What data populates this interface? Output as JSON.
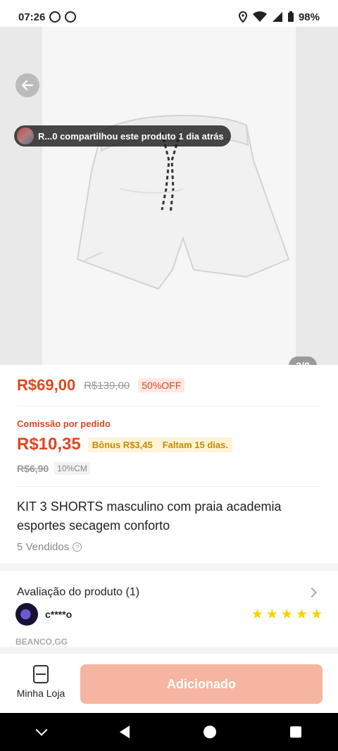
{
  "status_bar": {
    "time": "07:26",
    "battery": "98%"
  },
  "gallery": {
    "share_text": "R...0 compartilhou este produto 1 dia atrás",
    "counter": "2/8"
  },
  "pricing": {
    "price": "R$69,00",
    "old_price": "R$139,00",
    "discount": "50%OFF"
  },
  "commission": {
    "label": "Comissão por pedido",
    "amount": "R$10,35",
    "bonus": "Bônus R$3,45",
    "remaining": "Faltam 15 dias.",
    "old_amount": "R$6,90",
    "rate": "10%CM"
  },
  "product": {
    "title": "KIT 3 SHORTS masculino com praia academia esportes secagem conforto",
    "sold": "5 Vendidos"
  },
  "review": {
    "title": "Avaliação do produto (1)",
    "reviewer_name": "c****o",
    "rating": 5,
    "shop_tag": "BEANCO,GG"
  },
  "bottom_bar": {
    "store_label": "Minha Loja",
    "add_label": "Adicionado"
  },
  "colors": {
    "accent": "#e2461f",
    "bonus": "#c58a00",
    "button_disabled": "#f6b5a1"
  }
}
